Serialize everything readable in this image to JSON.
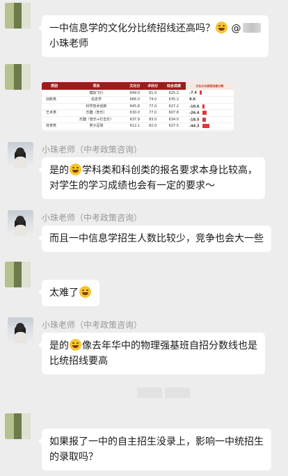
{
  "messages": [
    {
      "sender": "self",
      "text": "一中信息学的文化分比统招线还高吗？",
      "emoji": "laugh-cry",
      "mention": "@",
      "line2": "小珠老师"
    },
    {
      "sender": "self",
      "type": "image",
      "table": {
        "headers": [
          "类别",
          "项目",
          "文化分",
          "术科分",
          "综合成绩",
          "文化分与统招线差分数"
        ],
        "rows": [
          [
            "",
            "模拟飞行",
            "649.0",
            "61.0",
            "625.2",
            "-7.4"
          ],
          [
            "创新类",
            "信息学",
            "666.0",
            "74.0",
            "635.2",
            "9.6"
          ],
          [
            "",
            "科学技术创新",
            "645.8",
            "77.0",
            "627.2",
            "-10.6"
          ],
          [
            "艺术类",
            "乐器（管乐）",
            "630.0",
            "77.0",
            "607.8",
            "-26.4"
          ],
          [
            "",
            "乐器（管乐+打击乐）",
            "637.9",
            "83.0",
            "634.0",
            "-18.5"
          ],
          [
            "体育类",
            "男子足球",
            "612.1",
            "82.0",
            "627.5",
            "-44.3"
          ]
        ],
        "diff_values": [
          -7.4,
          9.6,
          -10.6,
          -26.4,
          -18.5,
          -44.3
        ]
      }
    },
    {
      "sender": "teacher",
      "name": "小珠老师（中考政策咨询）",
      "pre": "是的",
      "emoji": "grin",
      "line1": "学科类和科创类的报名要求本身比较高，",
      "line2": "对学生的学习成绩也会有一定的要求～"
    },
    {
      "sender": "teacher",
      "name": "小珠老师（中考政策咨询）",
      "line1": "而且一中信息学招生人数比较少，竞争也会大一些"
    },
    {
      "sender": "self",
      "text": "太难了",
      "emoji": "laugh-cry"
    },
    {
      "sender": "teacher",
      "name": "小珠老师（中考政策咨询）",
      "pre": "是的",
      "emoji": "laugh-cry",
      "line1": "像去年华中的物理强基班自招分数线也是",
      "line2": "比统招线要高"
    },
    {
      "sender": "self",
      "line1": "如果报了一中的自主招生没录上，影响一中统招生",
      "line2": "的录取吗？"
    }
  ],
  "colors": {
    "background": "#ededed",
    "bubble": "#ffffff",
    "name": "#999999",
    "header_red": "#9e1b1b",
    "accent_red": "#e03a3a"
  }
}
